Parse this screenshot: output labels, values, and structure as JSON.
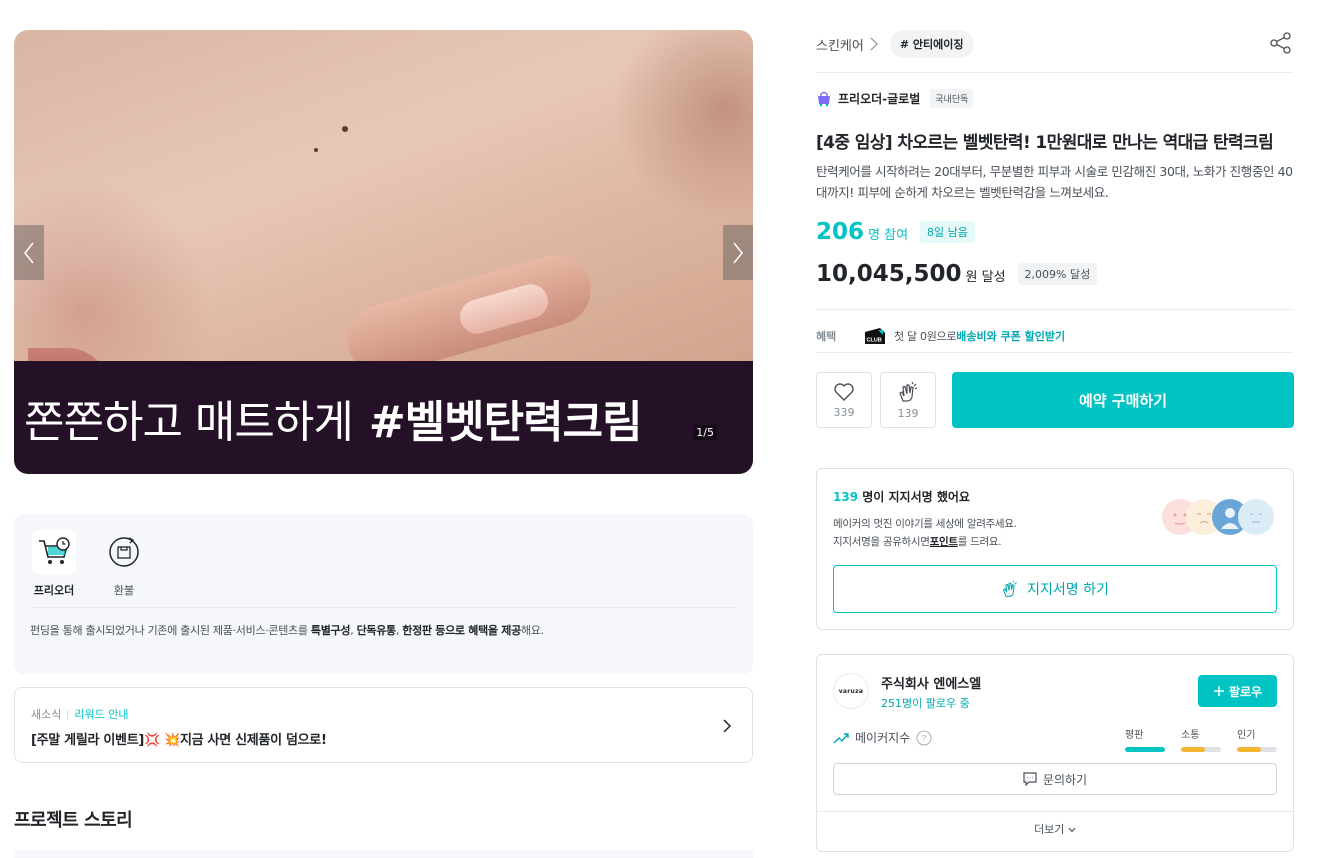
{
  "hero": {
    "banner_light": "쫀쫀하고 매트하게",
    "banner_bold": "#벨벳탄력크림",
    "counter": "1/5",
    "prev_icon": "chevron-left-icon",
    "next_icon": "chevron-right-icon"
  },
  "info": {
    "items": [
      {
        "label": "프리오더",
        "icon": "cart-clock-icon"
      },
      {
        "label": "환불",
        "icon": "refund-icon"
      }
    ],
    "desc_1": "펀딩을 통해 출시되었거나 기존에 출시된 제품·서비스·콘텐츠를 ",
    "desc_2": "특별구성",
    "desc_3": ", ",
    "desc_4": "단독유통",
    "desc_5": ", ",
    "desc_6": "한정판 등으로 혜택을 제공",
    "desc_7": "해요."
  },
  "news": {
    "tag1": "새소식",
    "tag2": "리워드 안내",
    "title": "[주말 게릴라 이벤트]💢 💥지금 사면 신제품이 덤으로!"
  },
  "story": {
    "title": "프로젝트 스토리"
  },
  "crumb": {
    "category": "스킨케어",
    "tag": "# 안티에이징"
  },
  "maker_line": {
    "name": "프리오더-글로벌",
    "badge": "국내단독"
  },
  "product": {
    "title": "[4중 임상] 차오르는 벨벳탄력! 1만원대로 만나는 역대급 탄력크림",
    "desc": "탄력케어를 시작하려는 20대부터, 무분별한 피부과 시술로 민감해진 30대, 노화가 진행중인 40대까지! 피부에 순하게 차오르는 벨벳탄력감을 느껴보세요."
  },
  "stats": {
    "participants": "206",
    "participants_unit": "명 참여",
    "days_left": "8일 남음",
    "amount": "10,045,500",
    "amount_unit": "원 달성",
    "percent": "2,009% 달성"
  },
  "benefit": {
    "label": "혜택",
    "club": "CLUB",
    "text": "첫 달 0원으로 ",
    "link": "배송비와 쿠폰 할인받기"
  },
  "actions": {
    "like_count": "339",
    "cheer_count": "139",
    "buy_label": "예약 구매하기"
  },
  "support": {
    "count": "139",
    "head": " 명이 지지서명 했어요",
    "sub1": "메이커의 멋진 이야기를 세상에 알려주세요.",
    "sub2a": "지지서명을 공유하시면",
    "sub2b": "포인트",
    "sub2c": "를 드려요.",
    "button": "지지서명 하기"
  },
  "maker": {
    "logo": "varuza",
    "name": "주식회사 엔에스엘",
    "followers": "251명이 팔로우 중",
    "follow_label": "팔로우",
    "index_label": "메이커지수",
    "metrics": [
      {
        "label": "평판",
        "level": 1.0,
        "color": "#00c4c4"
      },
      {
        "label": "소통",
        "level": 0.6,
        "color": "#f5b731"
      },
      {
        "label": "인기",
        "level": 0.6,
        "color": "#f5b731"
      }
    ],
    "inquiry_label": "문의하기",
    "more_label": "더보기"
  }
}
